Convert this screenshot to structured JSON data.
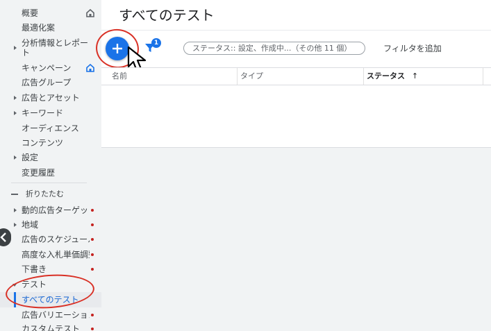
{
  "sidebar": {
    "items": [
      {
        "label": "概要"
      },
      {
        "label": "最適化案"
      },
      {
        "label": "分析情報とレポート"
      },
      {
        "label": "キャンペーン"
      },
      {
        "label": "広告グループ"
      },
      {
        "label": "広告とアセット"
      },
      {
        "label": "キーワード"
      },
      {
        "label": "オーディエンス"
      },
      {
        "label": "コンテンツ"
      },
      {
        "label": "設定"
      },
      {
        "label": "変更履歴"
      }
    ],
    "collapse_label": "折りたたむ",
    "more_items": [
      {
        "label": "動的広告ターゲット"
      },
      {
        "label": "地域"
      },
      {
        "label": "広告のスケジュール"
      },
      {
        "label": "高度な入札単価調整"
      },
      {
        "label": "下書き"
      },
      {
        "label": "テスト"
      },
      {
        "label": "すべてのテスト"
      },
      {
        "label": "広告バリエーション"
      },
      {
        "label": "カスタムテスト"
      }
    ]
  },
  "main": {
    "title": "すべてのテスト",
    "filter_badge": "1",
    "filter_chip": "ステータス:: 設定、作成中...（その他 11 個）",
    "add_filter": "フィルタを追加",
    "columns": {
      "name": "名前",
      "type": "タイプ",
      "status": "ステータス"
    },
    "sort_indicator": "↑"
  },
  "colors": {
    "accent": "#1a73e8",
    "annotation": "#d93025",
    "sidebar_bg": "#f1f3f4"
  }
}
